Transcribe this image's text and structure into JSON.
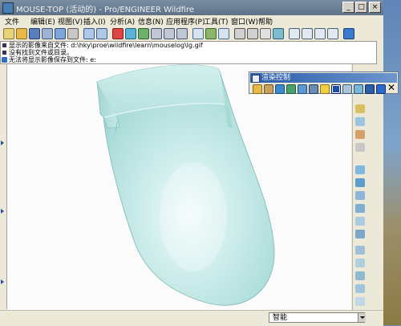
{
  "window": {
    "title": "MOUSE-TOP (活动的) - Pro/ENGINEER Wildfire"
  },
  "menu": {
    "items": [
      {
        "label": "文件"
      },
      {
        "label": "编辑(E)"
      },
      {
        "label": "视图(V)"
      },
      {
        "label": "插入(I)"
      },
      {
        "label": "分析(A)"
      },
      {
        "label": "信息(N)"
      },
      {
        "label": "应用程序(P)"
      },
      {
        "label": "工具(T)"
      },
      {
        "label": "窗口(W)"
      },
      {
        "label": "帮助"
      }
    ]
  },
  "messages": {
    "lines": [
      {
        "text": "显示的影像来自文件: d:\\hky\\proe\\wildfire\\learn\\mouselog\\lg.gif"
      },
      {
        "text": "没有找到文件或目录。"
      },
      {
        "text": "无法将显示影像保存到文件: e:"
      }
    ]
  },
  "render_panel": {
    "title": "渲染控制"
  },
  "status": {
    "filter": "智能"
  },
  "colors": {
    "model": "#bfe4e2",
    "titlebar": "#6f8398",
    "panel_title": "#2a5ca8"
  }
}
